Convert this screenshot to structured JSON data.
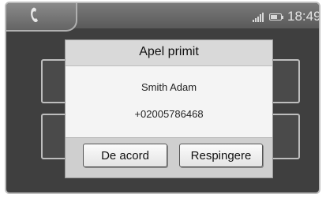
{
  "status_bar": {
    "time": "18:49",
    "phone_icon": "phone-handset-icon",
    "signal_icon": "signal-strength-icon",
    "battery_icon": "battery-icon",
    "battery_level": 0.7
  },
  "dialog": {
    "title": "Apel primit",
    "caller_name": "Smith Adam",
    "caller_number": "+02005786468",
    "accept_label": "De acord",
    "reject_label": "Respingere"
  }
}
